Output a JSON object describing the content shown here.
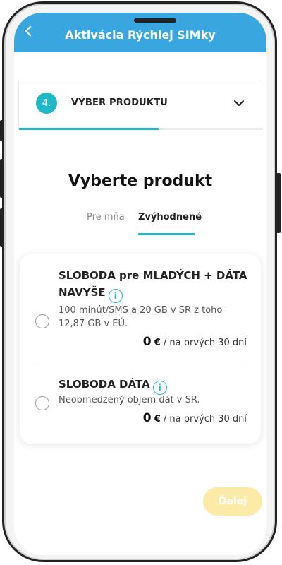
{
  "header": {
    "title": "Aktivácia Rýchlej SIMky",
    "back_icon": "chevron-left-icon"
  },
  "step": {
    "number": "4.",
    "label": "VÝBER PRODUKTU",
    "chevron_icon": "chevron-down-icon"
  },
  "section_title": "Vyberte produkt",
  "tabs": [
    {
      "label": "Pre mňa",
      "active": false
    },
    {
      "label": "Zvýhodnené",
      "active": true
    }
  ],
  "products": [
    {
      "name": "SLOBODA pre MLADÝCH + DÁTA NAVYŠE",
      "description": "100 minút/SMS a 20 GB v SR z toho 12,87 GB v EÚ.",
      "price_value": "0",
      "price_currency": "€",
      "price_suffix": " / na prvých 30 dní",
      "selected": false
    },
    {
      "name": "SLOBODA DÁTA",
      "description": "Neobmedzený objem dát v SR.",
      "price_value": "0",
      "price_currency": "€",
      "price_suffix": " / na prvých 30 dní",
      "selected": false
    }
  ],
  "next_button": {
    "label": "Ďalej"
  },
  "colors": {
    "header": "#3aa6df",
    "accent": "#1fb8c6",
    "next_button_bg": "#fbeba6"
  }
}
